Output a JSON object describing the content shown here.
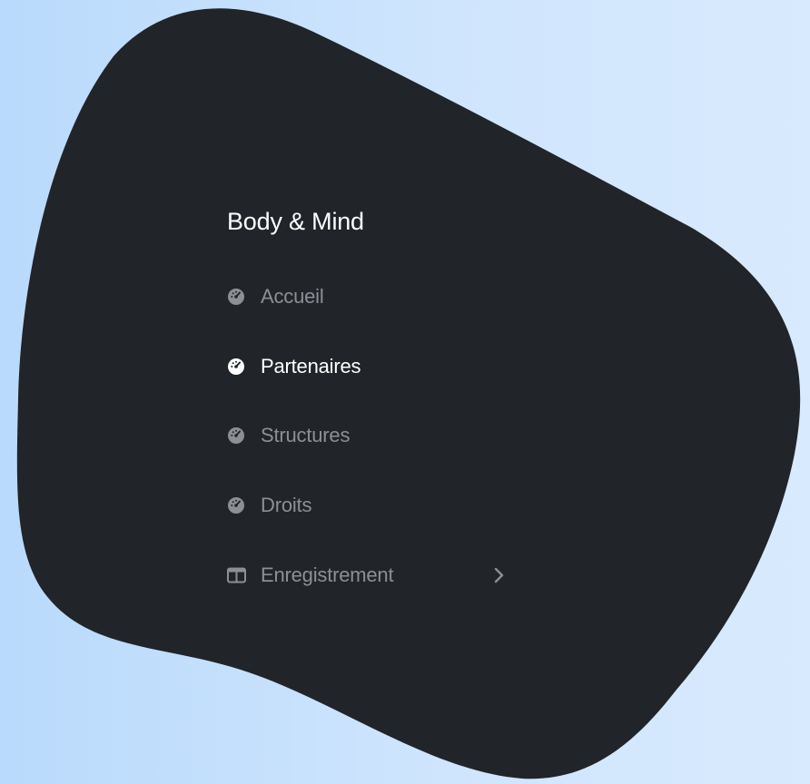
{
  "sidebar": {
    "brand": "Body & Mind",
    "items": [
      {
        "label": "Accueil",
        "icon": "dashboard-gauge-icon",
        "active": false
      },
      {
        "label": "Partenaires",
        "icon": "dashboard-gauge-icon",
        "active": true
      },
      {
        "label": "Structures",
        "icon": "dashboard-gauge-icon",
        "active": false
      },
      {
        "label": "Droits",
        "icon": "dashboard-gauge-icon",
        "active": false
      },
      {
        "label": "Enregistrement",
        "icon": "columns-icon",
        "active": false,
        "expandable": true
      }
    ]
  },
  "colors": {
    "background_left": "#b9dafc",
    "background_right": "#d8eafd",
    "blob": "#212429",
    "text_active": "#ffffff",
    "text_inactive": "#8c8f94"
  }
}
